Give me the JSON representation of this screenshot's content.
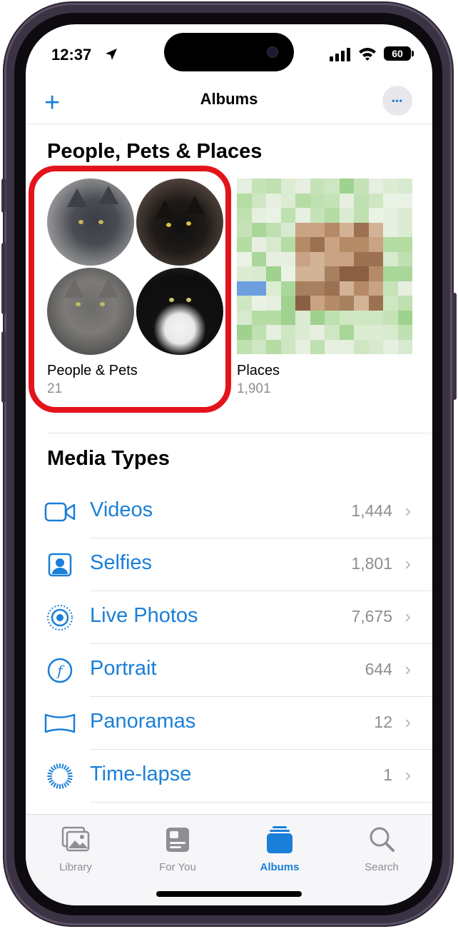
{
  "status_bar": {
    "time": "12:37",
    "battery": "60"
  },
  "nav": {
    "add_label": "+",
    "title": "Albums",
    "more_label": "•••"
  },
  "people_section": {
    "title": "People, Pets & Places",
    "people_album": {
      "label": "People & Pets",
      "count": "21"
    },
    "places_album": {
      "label": "Places",
      "count": "1,901"
    }
  },
  "media_section": {
    "title": "Media Types",
    "items": [
      {
        "label": "Videos",
        "count": "1,444",
        "icon": "video-icon"
      },
      {
        "label": "Selfies",
        "count": "1,801",
        "icon": "selfie-icon"
      },
      {
        "label": "Live Photos",
        "count": "7,675",
        "icon": "live-photo-icon"
      },
      {
        "label": "Portrait",
        "count": "644",
        "icon": "portrait-icon"
      },
      {
        "label": "Panoramas",
        "count": "12",
        "icon": "panorama-icon"
      },
      {
        "label": "Time-lapse",
        "count": "1",
        "icon": "timelapse-icon"
      }
    ]
  },
  "tabbar": {
    "tabs": [
      {
        "label": "Library",
        "active": false
      },
      {
        "label": "For You",
        "active": false
      },
      {
        "label": "Albums",
        "active": true
      },
      {
        "label": "Search",
        "active": false
      }
    ]
  },
  "colors": {
    "accent": "#1a7fd8",
    "highlight": "#e3141b",
    "secondary_text": "#8e8e93"
  }
}
